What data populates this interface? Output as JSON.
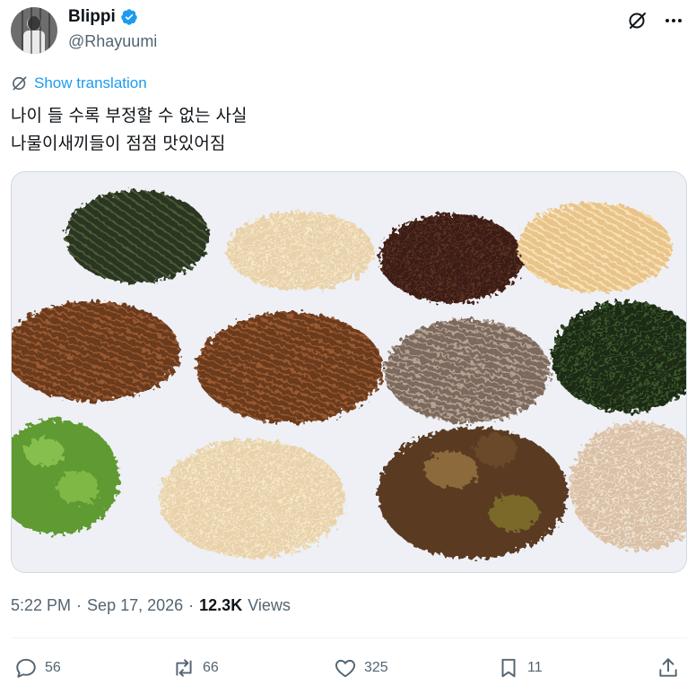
{
  "user": {
    "display_name": "Blippi",
    "handle": "@Rhayuumi",
    "verified": true
  },
  "translate": {
    "label": "Show translation"
  },
  "tweet": {
    "line1": "나이 들 수록 부정할 수 없는 사실",
    "line2": "나물이새끼들이 점점 맛있어짐"
  },
  "meta": {
    "time": "5:22 PM",
    "separator1": "·",
    "date": "Sep 17, 2026",
    "separator2": "·",
    "views_count": "12.3K",
    "views_label": "Views"
  },
  "actions": {
    "replies": "56",
    "reposts": "66",
    "likes": "325",
    "bookmarks": "11"
  },
  "colors": {
    "accent": "#1d9bf0",
    "muted": "#536471",
    "text": "#0f1419"
  }
}
